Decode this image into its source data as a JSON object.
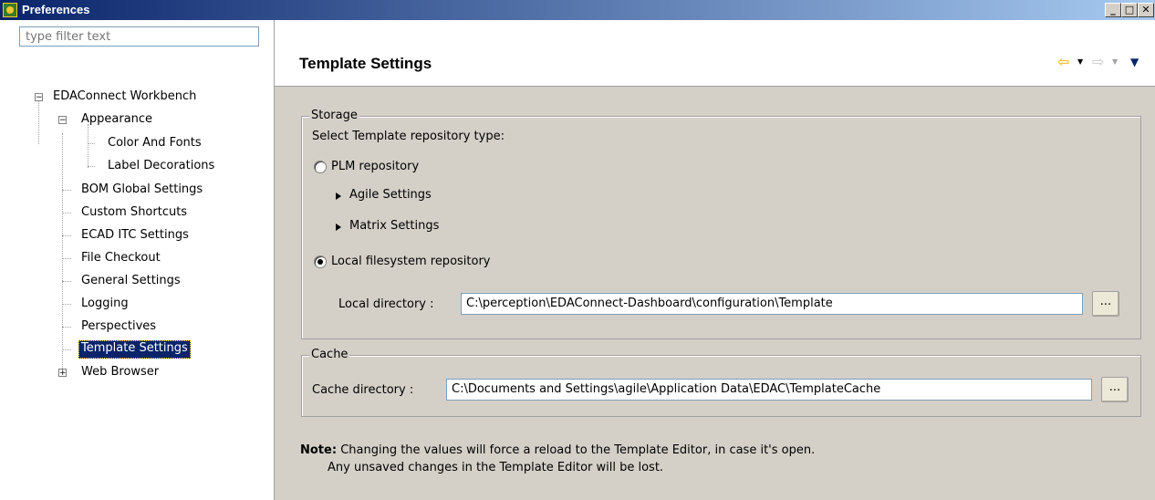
{
  "window": {
    "title": "Preferences",
    "minimize": "_",
    "maximize": "□",
    "close": "✕"
  },
  "sidebar": {
    "filter_placeholder": "type filter text",
    "tree": {
      "root": "EDAConnect Workbench",
      "appearance": "Appearance",
      "color_and_fonts": "Color And Fonts",
      "label_decorations": "Label Decorations",
      "bom_global_settings": "BOM Global Settings",
      "custom_shortcuts": "Custom Shortcuts",
      "ecad_itc_settings": "ECAD ITC Settings",
      "file_checkout": "File Checkout",
      "general_settings": "General Settings",
      "logging": "Logging",
      "perspectives": "Perspectives",
      "template_settings": "Template Settings",
      "web_browser": "Web Browser"
    },
    "expander_minus": "−",
    "expander_plus": "+"
  },
  "main": {
    "title": "Template Settings",
    "storage": {
      "legend": "Storage",
      "prompt": "Select Template repository type:",
      "plm_label": "PLM repository",
      "agile_settings": "Agile Settings",
      "matrix_settings": "Matrix Settings",
      "local_label": "Local filesystem repository",
      "local_dir_label": "Local directory :",
      "local_dir_value": "C:\\perception\\EDAConnect-Dashboard\\configuration\\Template",
      "browse_label": "...",
      "selected_repository": "Local filesystem repository"
    },
    "cache": {
      "legend": "Cache",
      "dir_label": "Cache directory :",
      "dir_value": "C:\\Documents and Settings\\agile\\Application Data\\EDAC\\TemplateCache",
      "browse_label": "..."
    },
    "note": {
      "label": "Note:",
      "line1": "Changing the values will force a reload to the Template Editor, in case it's open.",
      "line2": "Any unsaved changes in the Template Editor will be lost."
    }
  },
  "colors": {
    "titlebar_start": "#0a246a",
    "titlebar_end": "#a6caf0",
    "selection": "#0a246a",
    "back_arrow": "#f4c430"
  },
  "icons": {
    "back": "back-arrow-icon",
    "forward": "forward-arrow-icon",
    "menu": "view-menu-icon"
  }
}
